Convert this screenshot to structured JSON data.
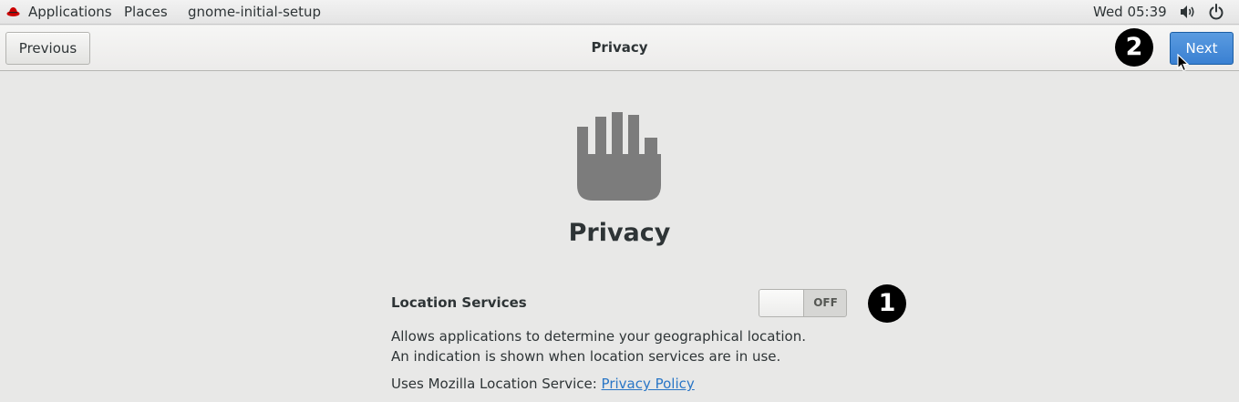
{
  "topbar": {
    "applications": "Applications",
    "places": "Places",
    "app_name": "gnome-initial-setup",
    "clock": "Wed 05:39",
    "icons": [
      "redhat-logo-icon",
      "volume-icon",
      "power-icon"
    ]
  },
  "header": {
    "previous_label": "Previous",
    "title": "Privacy",
    "next_label": "Next"
  },
  "annotations": {
    "marker_1": "1",
    "marker_2": "2"
  },
  "content": {
    "icon": "privacy-hand-icon",
    "heading": "Privacy",
    "location": {
      "label": "Location Services",
      "toggle_state": "OFF",
      "description": "Allows applications to determine your geographical location. An indication is shown when location services are in use.",
      "provider_prefix": "Uses Mozilla Location Service: ",
      "policy_link": "Privacy Policy"
    }
  },
  "colors": {
    "accent": "#3a80d2",
    "link": "#2a76c6",
    "background": "#e8e8e7",
    "icon_gray": "#7c7c7c"
  }
}
